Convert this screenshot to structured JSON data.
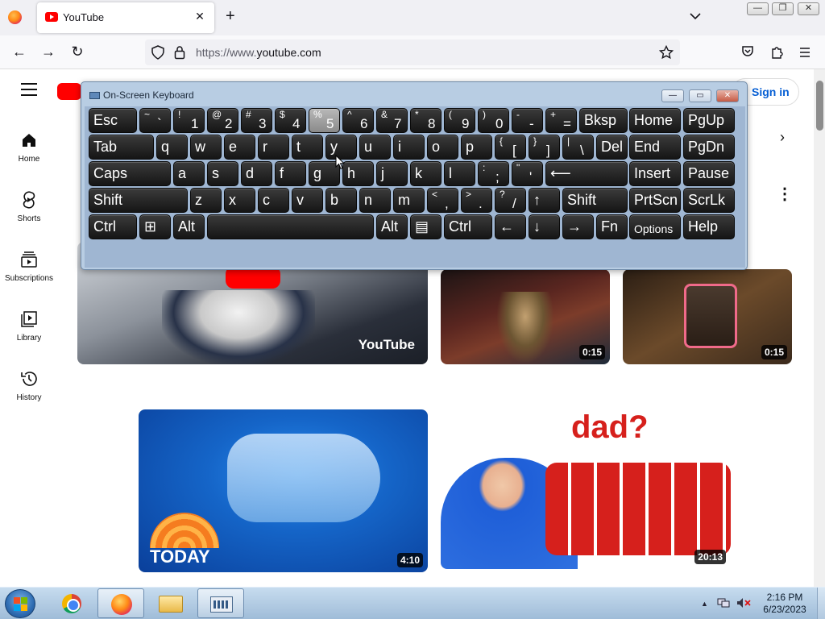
{
  "browser": {
    "tab": {
      "title": "YouTube",
      "close_glyph": "✕"
    },
    "new_tab_glyph": "+",
    "tab_list_glyph": "⌄",
    "window_controls": {
      "minimize": "—",
      "restore": "❐",
      "close": "✕"
    },
    "nav": {
      "back": "←",
      "forward": "→",
      "reload": "↻"
    },
    "url": {
      "prefix": "https://www.",
      "domain": "youtube.com"
    },
    "toolbar_icons": [
      "shield-icon",
      "lock-icon",
      "bookmark-star-icon",
      "pocket-icon",
      "extensions-icon",
      "app-menu-icon"
    ]
  },
  "youtube": {
    "signin_label": "Sign in",
    "sidebar": [
      {
        "label": "Home",
        "icon": "home-icon"
      },
      {
        "label": "Shorts",
        "icon": "shorts-icon"
      },
      {
        "label": "Subscriptions",
        "icon": "subscriptions-icon"
      },
      {
        "label": "Library",
        "icon": "library-icon"
      },
      {
        "label": "History",
        "icon": "history-icon"
      }
    ],
    "chips_next": "›",
    "more_glyph": "⋮",
    "videos": [
      {
        "duration": "",
        "overlay_text": "YouTube",
        "colors": [
          "#cfd3d8",
          "#2a2f3a",
          "#e8e8e8"
        ]
      },
      {
        "duration": "0:15",
        "colors": [
          "#3a1e1a",
          "#7a2a2a",
          "#1d2b3a"
        ]
      },
      {
        "duration": "0:15",
        "colors": [
          "#2c1e14",
          "#6b4a2a",
          "#e07080"
        ]
      },
      {
        "duration": "4:10",
        "overlay_text": "TODAY",
        "colors": [
          "#0a3f9a",
          "#1c7fe0",
          "#f57c1f"
        ]
      },
      {
        "duration": "20:13",
        "overlay_text": "dad?",
        "colors": [
          "#ffffff",
          "#d6201c",
          "#1f5fd8"
        ]
      }
    ]
  },
  "osk": {
    "title": "On-Screen Keyboard",
    "controls": {
      "minimize": "—",
      "restore": "▭",
      "close": "✕"
    },
    "rows": [
      [
        {
          "main": "Esc"
        },
        {
          "shift": "~",
          "base": "`"
        },
        {
          "shift": "!",
          "base": "1"
        },
        {
          "shift": "@",
          "base": "2"
        },
        {
          "shift": "#",
          "base": "3"
        },
        {
          "shift": "$",
          "base": "4"
        },
        {
          "shift": "%",
          "base": "5",
          "pressed": true
        },
        {
          "shift": "^",
          "base": "6"
        },
        {
          "shift": "&",
          "base": "7"
        },
        {
          "shift": "*",
          "base": "8"
        },
        {
          "shift": "(",
          "base": "9"
        },
        {
          "shift": ")",
          "base": "0"
        },
        {
          "shift": "-",
          "base": "-"
        },
        {
          "shift": "+",
          "base": "="
        },
        {
          "main": "Bksp"
        },
        {
          "main": "Home"
        },
        {
          "main": "PgUp"
        }
      ],
      [
        {
          "main": "Tab"
        },
        {
          "main": "q"
        },
        {
          "main": "w"
        },
        {
          "main": "e"
        },
        {
          "main": "r"
        },
        {
          "main": "t"
        },
        {
          "main": "y"
        },
        {
          "main": "u"
        },
        {
          "main": "i"
        },
        {
          "main": "o"
        },
        {
          "main": "p"
        },
        {
          "shift": "{",
          "base": "["
        },
        {
          "shift": "}",
          "base": "]"
        },
        {
          "shift": "|",
          "base": "\\"
        },
        {
          "main": "Del"
        },
        {
          "main": "End"
        },
        {
          "main": "PgDn"
        }
      ],
      [
        {
          "main": "Caps"
        },
        {
          "main": "a"
        },
        {
          "main": "s"
        },
        {
          "main": "d"
        },
        {
          "main": "f"
        },
        {
          "main": "g"
        },
        {
          "main": "h"
        },
        {
          "main": "j"
        },
        {
          "main": "k"
        },
        {
          "main": "l"
        },
        {
          "shift": ":",
          "base": ";"
        },
        {
          "shift": "\"",
          "base": "'"
        },
        {
          "main": "⟵"
        },
        {
          "main": "Insert"
        },
        {
          "main": "Pause"
        }
      ],
      [
        {
          "main": "Shift"
        },
        {
          "main": "z"
        },
        {
          "main": "x"
        },
        {
          "main": "c"
        },
        {
          "main": "v"
        },
        {
          "main": "b"
        },
        {
          "main": "n"
        },
        {
          "main": "m"
        },
        {
          "shift": "<",
          "base": ","
        },
        {
          "shift": ">",
          "base": "."
        },
        {
          "shift": "?",
          "base": "/"
        },
        {
          "main": "↑"
        },
        {
          "main": "Shift"
        },
        {
          "main": "PrtScn"
        },
        {
          "main": "ScrLk"
        }
      ],
      [
        {
          "main": "Ctrl"
        },
        {
          "main": "⊞"
        },
        {
          "main": "Alt"
        },
        {
          "main": ""
        },
        {
          "main": "Alt"
        },
        {
          "main": "▤"
        },
        {
          "main": "Ctrl"
        },
        {
          "main": "←"
        },
        {
          "main": "↓"
        },
        {
          "main": "→"
        },
        {
          "main": "Fn"
        },
        {
          "main": "Options",
          "small": true
        },
        {
          "main": "Help"
        }
      ]
    ]
  },
  "taskbar": {
    "items": [
      "windows-start-icon",
      "chrome-icon",
      "firefox-icon",
      "file-explorer-icon",
      "on-screen-keyboard-icon"
    ],
    "tray": {
      "show_hidden": "▲",
      "time": "2:16 PM",
      "date": "6/23/2023"
    }
  }
}
